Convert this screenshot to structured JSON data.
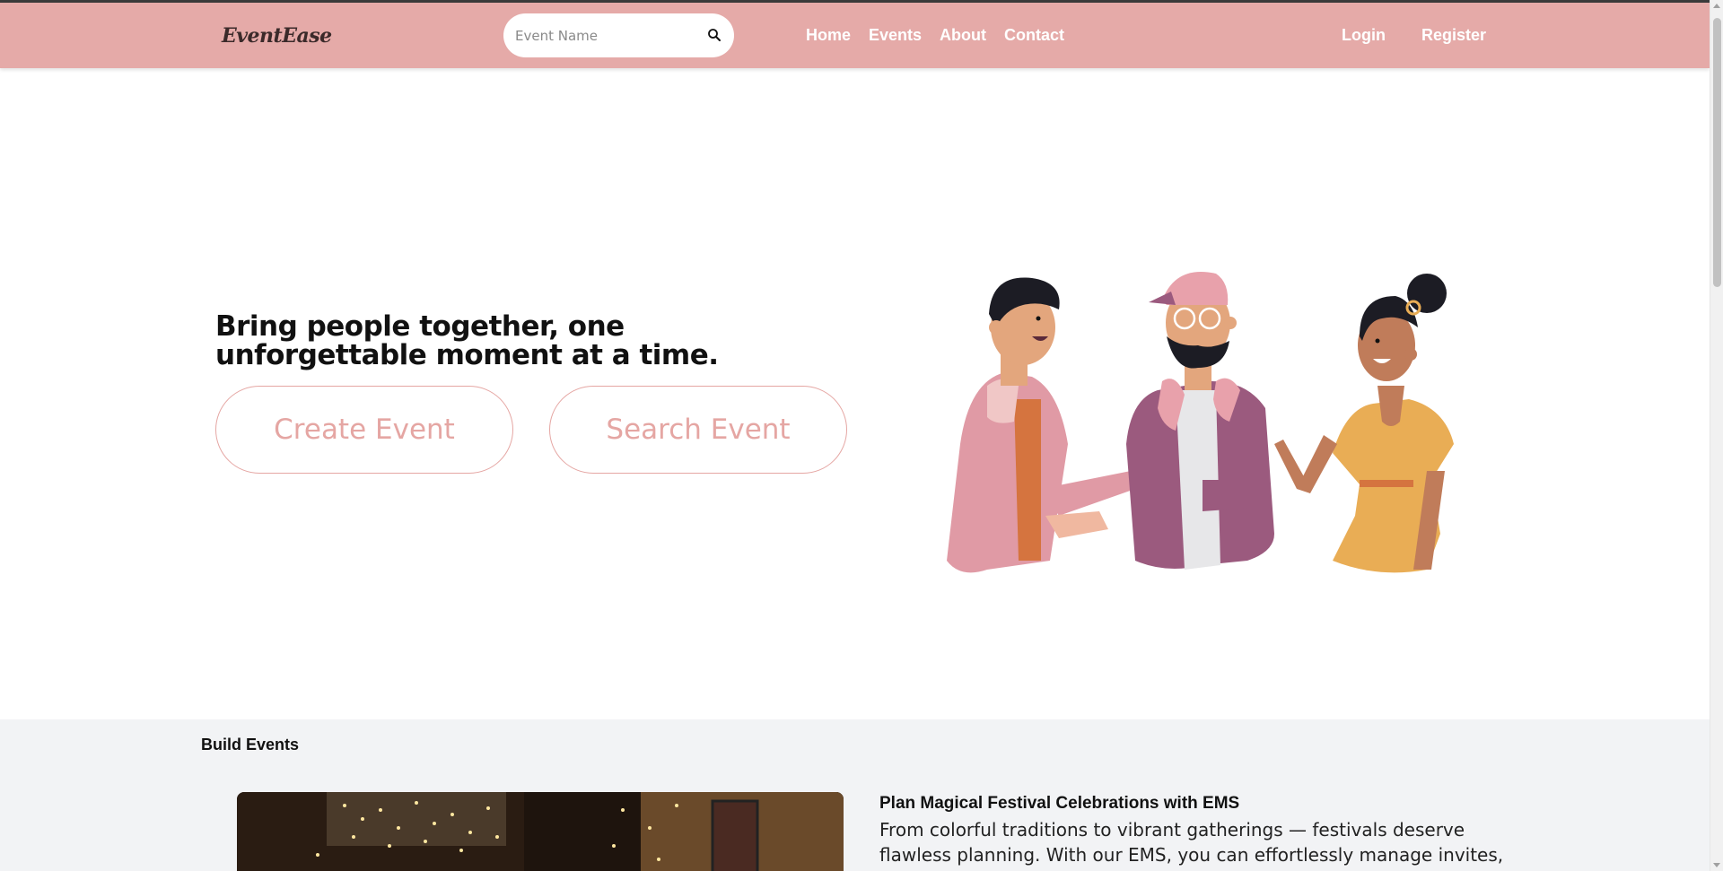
{
  "navbar": {
    "brand": "EventEase",
    "search_placeholder": "Event Name",
    "links": [
      "Home",
      "Events",
      "About",
      "Contact"
    ],
    "login": "Login",
    "register": "Register"
  },
  "hero": {
    "title": "Bring people together, one unforgettable moment at a time.",
    "create_button": "Create Event",
    "search_button": "Search Event"
  },
  "section": {
    "title": "Build Events",
    "event_heading": "Plan Magical Festival Celebrations with EMS",
    "event_desc": "From colorful traditions to vibrant gatherings — festivals deserve flawless planning. With our EMS, you can effortlessly manage invites, schedules,"
  },
  "colors": {
    "navbar_bg": "#e5aaa8",
    "accent": "#e5a6a3",
    "section_bg": "#f2f3f5"
  }
}
